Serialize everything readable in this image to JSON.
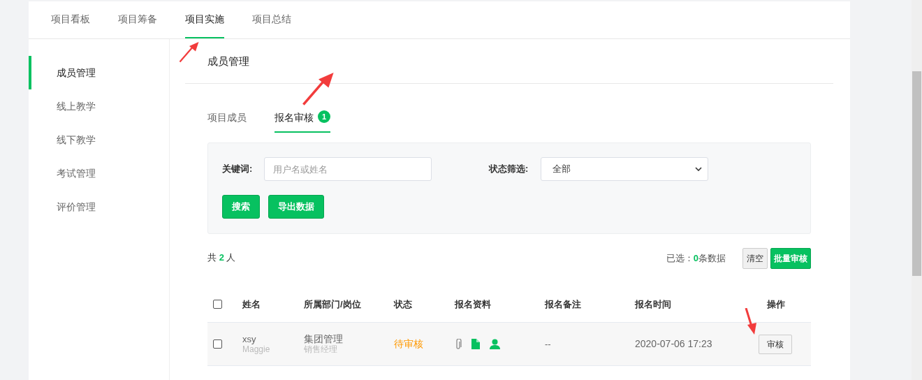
{
  "top_tabs": [
    {
      "label": "项目看板",
      "selected": false
    },
    {
      "label": "项目筹备",
      "selected": false
    },
    {
      "label": "项目实施",
      "selected": true
    },
    {
      "label": "项目总结",
      "selected": false
    }
  ],
  "sidebar": {
    "items": [
      {
        "label": "成员管理",
        "selected": true
      },
      {
        "label": "线上教学",
        "selected": false
      },
      {
        "label": "线下教学",
        "selected": false
      },
      {
        "label": "考试管理",
        "selected": false
      },
      {
        "label": "评价管理",
        "selected": false
      }
    ]
  },
  "page_title": "成员管理",
  "sub_tabs": [
    {
      "label": "项目成员",
      "selected": false
    },
    {
      "label": "报名审核",
      "selected": true,
      "badge": "1"
    }
  ],
  "filter": {
    "keyword_label": "关键词:",
    "keyword_placeholder": "用户名或姓名",
    "status_label": "状态筛选:",
    "status_value": "全部",
    "buttons": [
      "搜索",
      "导出数据"
    ]
  },
  "summary": {
    "total_prefix": "共",
    "total_count": "2",
    "total_suffix": "人",
    "selected_prefix": "已选：",
    "selected_count": "0",
    "selected_suffix": "条数据",
    "clear_button": "清空",
    "batch_button": "批量审核"
  },
  "table": {
    "select_all_checked": false,
    "columns": [
      "姓名",
      "所属部门/岗位",
      "状态",
      "报名资料",
      "报名备注",
      "报名时间",
      "操作"
    ],
    "rows": [
      {
        "checked": false,
        "name": "xsy",
        "alias": "Maggie",
        "department": "集团管理",
        "position": "销售经理",
        "status": "待审核",
        "color": "#ff9900",
        "remark": "--",
        "time": "2020-07-06 17:23",
        "action": "审核"
      }
    ]
  }
}
